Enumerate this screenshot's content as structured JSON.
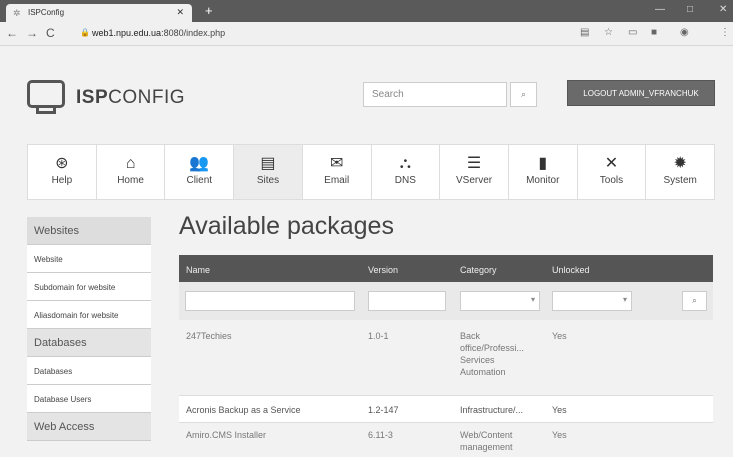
{
  "browser": {
    "tab_title": "ISPConfig",
    "url_host": "web1.npu.edu.ua",
    "url_rest": ":8080/index.php"
  },
  "header": {
    "logo_bold": "ISP",
    "logo_light": "CONFIG",
    "search_placeholder": "Search",
    "logout_label": "LOGOUT ADMIN_VFRANCHUK"
  },
  "modules": [
    {
      "label": "Help",
      "icon": "help-icon"
    },
    {
      "label": "Home",
      "icon": "home-icon"
    },
    {
      "label": "Client",
      "icon": "client-icon"
    },
    {
      "label": "Sites",
      "icon": "sites-icon"
    },
    {
      "label": "Email",
      "icon": "email-icon"
    },
    {
      "label": "DNS",
      "icon": "dns-icon"
    },
    {
      "label": "VServer",
      "icon": "vserver-icon"
    },
    {
      "label": "Monitor",
      "icon": "monitor-icon"
    },
    {
      "label": "Tools",
      "icon": "tools-icon"
    },
    {
      "label": "System",
      "icon": "system-icon"
    }
  ],
  "sidebar": {
    "websites_head": "Websites",
    "website": "Website",
    "subdomain": "Subdomain for website",
    "aliasdomain": "Aliasdomain for website",
    "databases_head": "Databases",
    "databases": "Databases",
    "database_users": "Database Users",
    "webaccess_head": "Web Access"
  },
  "main": {
    "title": "Available packages",
    "columns": [
      "Name",
      "Version",
      "Category",
      "Unlocked"
    ],
    "rows": [
      {
        "name": "247Techies",
        "version": "1.0-1",
        "category": "Back office/Professi... Services Automation",
        "unlocked": "Yes"
      },
      {
        "name": "Acronis Backup as a Service",
        "version": "1.2-147",
        "category": "Infrastructure/...",
        "unlocked": "Yes"
      },
      {
        "name": "Amiro.CMS Installer",
        "version": "6.11-3",
        "category": "Web/Content management",
        "unlocked": "Yes"
      }
    ]
  }
}
